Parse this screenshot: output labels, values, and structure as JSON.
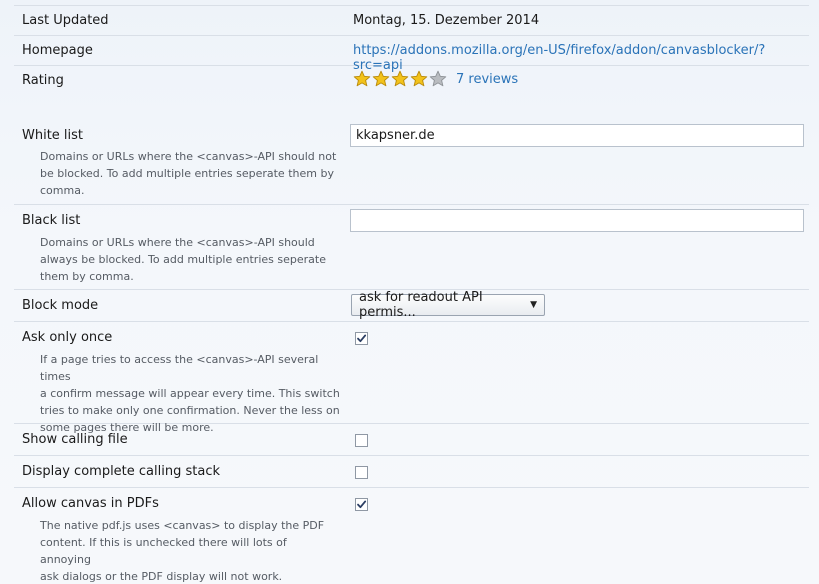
{
  "rows": {
    "last_updated": {
      "label": "Last Updated",
      "value": "Montag, 15. Dezember 2014"
    },
    "homepage": {
      "label": "Homepage",
      "value": "https://addons.mozilla.org/en-US/firefox/addon/canvasblocker/?src=api"
    },
    "rating": {
      "label": "Rating",
      "stars": 4,
      "max_stars": 5,
      "reviews": "7 reviews"
    },
    "white_list": {
      "label": "White list",
      "value": "kkapsner.de",
      "desc1": "Domains or URLs where the <canvas>-API should not",
      "desc2": "be blocked. To add multiple entries seperate them by",
      "desc3": "comma."
    },
    "black_list": {
      "label": "Black list",
      "value": "",
      "desc1": "Domains or URLs where the <canvas>-API should",
      "desc2": "always be blocked. To add multiple entries seperate",
      "desc3": "them by comma."
    },
    "block_mode": {
      "label": "Block mode",
      "selected": "ask for readout API permis..."
    },
    "ask_only_once": {
      "label": "Ask only once",
      "checked": true,
      "desc1": "If a page tries to access the <canvas>-API several times",
      "desc2": "a confirm message will appear every time. This switch",
      "desc3": "tries to make only one confirmation. Never the less on",
      "desc4": "some pages there will be more."
    },
    "show_calling_file": {
      "label": "Show calling file",
      "checked": false
    },
    "display_calling_stack": {
      "label": "Display complete calling stack",
      "checked": false
    },
    "allow_pdfs": {
      "label": "Allow canvas in PDFs",
      "checked": true,
      "desc1": "The native pdf.js uses <canvas> to display the PDF",
      "desc2": "content. If this is unchecked there will lots of annoying",
      "desc3": "ask dialogs or the PDF display will not work."
    }
  },
  "colors": {
    "link": "#2a73b8",
    "star_filled": "#f2c21b",
    "star_empty": "#b9bcc0"
  }
}
